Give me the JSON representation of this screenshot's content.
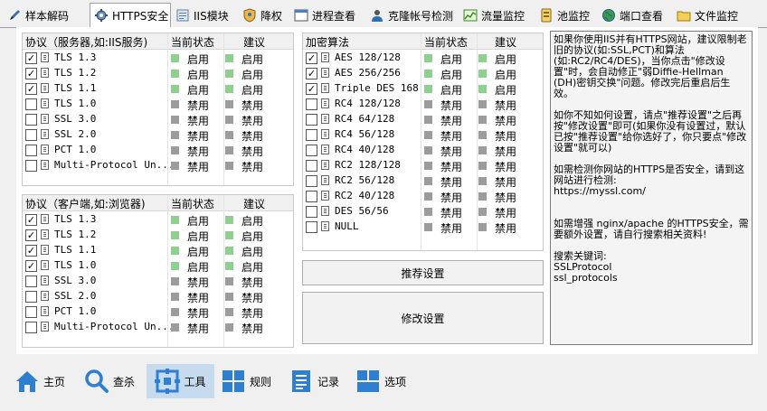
{
  "tabs": [
    {
      "label": "样本解码",
      "icon": "pen-icon",
      "active": false
    },
    {
      "label": "HTTPS安全",
      "icon": "gear-icon",
      "active": true
    },
    {
      "label": "IIS模块",
      "icon": "module-icon",
      "active": false
    },
    {
      "label": "降权",
      "icon": "shield-user-icon",
      "active": false
    },
    {
      "label": "进程查看",
      "icon": "window-icon",
      "active": false
    },
    {
      "label": "克隆帐号检测",
      "icon": "user-icon",
      "active": false
    },
    {
      "label": "流量监控",
      "icon": "chart-icon",
      "active": false
    },
    {
      "label": "池监控",
      "icon": "pool-icon",
      "active": false
    },
    {
      "label": "端口查看",
      "icon": "globe-icon",
      "active": false
    },
    {
      "label": "文件监控",
      "icon": "folder-icon",
      "active": false
    }
  ],
  "server_protocols": {
    "headers": [
      "协议（服务器,如:IIS服务)",
      "当前状态",
      "建议"
    ],
    "rows": [
      {
        "name": "TLS 1.3",
        "checked": true,
        "status": "启用",
        "suggest": "启用"
      },
      {
        "name": "TLS 1.2",
        "checked": true,
        "status": "启用",
        "suggest": "启用"
      },
      {
        "name": "TLS 1.1",
        "checked": true,
        "status": "启用",
        "suggest": "启用"
      },
      {
        "name": "TLS 1.0",
        "checked": false,
        "status": "禁用",
        "suggest": "禁用"
      },
      {
        "name": "SSL 3.0",
        "checked": false,
        "status": "禁用",
        "suggest": "禁用"
      },
      {
        "name": "SSL 2.0",
        "checked": false,
        "status": "禁用",
        "suggest": "禁用"
      },
      {
        "name": "PCT 1.0",
        "checked": false,
        "status": "禁用",
        "suggest": "禁用"
      },
      {
        "name": "Multi-Protocol Un...",
        "checked": false,
        "status": "禁用",
        "suggest": "禁用"
      }
    ]
  },
  "client_protocols": {
    "headers": [
      "协议（客户端,如:浏览器)",
      "当前状态",
      "建议"
    ],
    "rows": [
      {
        "name": "TLS 1.3",
        "checked": true,
        "status": "启用",
        "suggest": "启用"
      },
      {
        "name": "TLS 1.2",
        "checked": true,
        "status": "启用",
        "suggest": "启用"
      },
      {
        "name": "TLS 1.1",
        "checked": true,
        "status": "启用",
        "suggest": "启用"
      },
      {
        "name": "TLS 1.0",
        "checked": true,
        "status": "启用",
        "suggest": "启用"
      },
      {
        "name": "SSL 3.0",
        "checked": false,
        "status": "禁用",
        "suggest": "禁用"
      },
      {
        "name": "SSL 2.0",
        "checked": false,
        "status": "禁用",
        "suggest": "禁用"
      },
      {
        "name": "PCT 1.0",
        "checked": false,
        "status": "禁用",
        "suggest": "禁用"
      },
      {
        "name": "Multi-Protocol Un...",
        "checked": false,
        "status": "禁用",
        "suggest": "禁用"
      }
    ]
  },
  "ciphers": {
    "headers": [
      "加密算法",
      "当前状态",
      "建议"
    ],
    "rows": [
      {
        "name": "AES 128/128",
        "checked": true,
        "status": "启用",
        "suggest": "启用"
      },
      {
        "name": "AES 256/256",
        "checked": true,
        "status": "启用",
        "suggest": "启用"
      },
      {
        "name": "Triple DES 168",
        "checked": true,
        "status": "启用",
        "suggest": "启用"
      },
      {
        "name": "RC4 128/128",
        "checked": false,
        "status": "禁用",
        "suggest": "禁用"
      },
      {
        "name": "RC4 64/128",
        "checked": false,
        "status": "禁用",
        "suggest": "禁用"
      },
      {
        "name": "RC4 56/128",
        "checked": false,
        "status": "禁用",
        "suggest": "禁用"
      },
      {
        "name": "RC4 40/128",
        "checked": false,
        "status": "禁用",
        "suggest": "禁用"
      },
      {
        "name": "RC2 128/128",
        "checked": false,
        "status": "禁用",
        "suggest": "禁用"
      },
      {
        "name": "RC2 56/128",
        "checked": false,
        "status": "禁用",
        "suggest": "禁用"
      },
      {
        "name": "RC2 40/128",
        "checked": false,
        "status": "禁用",
        "suggest": "禁用"
      },
      {
        "name": "DES 56/56",
        "checked": false,
        "status": "禁用",
        "suggest": "禁用"
      },
      {
        "name": "NULL",
        "checked": false,
        "status": "禁用",
        "suggest": "禁用"
      }
    ]
  },
  "buttons": {
    "recommend": "推荐设置",
    "apply": "修改设置"
  },
  "info_text": "如果你使用IIS并有HTTPS网站，建议限制老旧的协议(如:SSL,PCT)和算法(如:RC2/RC4/DES)，当你点击\"修改设置\"时，会自动修正\"弱Diffie-Hellman (DH)密钥交换\"问题。修改完后重启后生效。\n\n如你不知如何设置，请点\"推荐设置\"之后再按\"修改设置\"即可(如果你没有设置过，默认已按\"推荐设置\"给你选好了，你只要点\"修改设置\"就可以)\n\n如需检测你网站的HTTPS是否安全，请到这网站进行检测:\nhttps://myssl.com/\n\n\n如需增强 nginx/apache 的HTTPS安全，需要额外设置，请自行搜索相关资料!\n\n搜索关键词:\nSSLProtocol\nssl_protocols",
  "nav": [
    {
      "label": "主页",
      "icon": "home-icon",
      "active": false
    },
    {
      "label": "查杀",
      "icon": "search-icon",
      "active": false
    },
    {
      "label": "工具",
      "icon": "tools-icon",
      "active": true
    },
    {
      "label": "规则",
      "icon": "grid-icon",
      "active": false
    },
    {
      "label": "记录",
      "icon": "document-icon",
      "active": false
    },
    {
      "label": "选项",
      "icon": "options-icon",
      "active": false
    }
  ],
  "colors": {
    "enabled": "#8ed08e",
    "disabled": "#9c9c9c",
    "accent": "#2f7fd1"
  }
}
